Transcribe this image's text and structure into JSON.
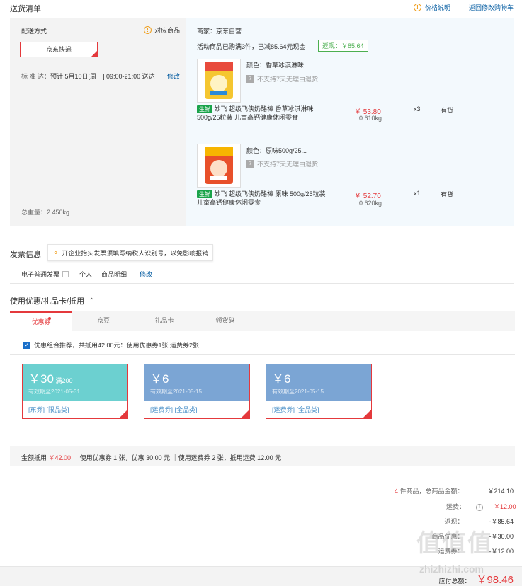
{
  "header": {
    "title": "送货清单",
    "price_explain": "价格说明",
    "back_to_cart": "返回修改购物车"
  },
  "delivery": {
    "label": "配送方式",
    "match_goods": "对应商品",
    "method": "京东快递",
    "standard_label": "标 准 达：",
    "estimate": "预计 5月10日[周一] 09:00-21:00 送达",
    "modify": "修改",
    "total_weight_label": "总重量：",
    "total_weight": "2.450kg"
  },
  "merchant": {
    "label": "商家：",
    "name": "京东自营",
    "promo": "活动商品已购满3件，已减85.64元现金",
    "rebate": "返现：￥85.64"
  },
  "products": [
    {
      "color": "颜色：香草冰淇淋味...",
      "no_return": "不支持7天无理由退货",
      "tag": "生鲜",
      "name": "妙飞 超级飞侠奶酪棒 香草冰淇淋味 500g/25粒装 儿童高钙健康休闲零食",
      "price": "￥ 53.80",
      "weight": "0.610kg",
      "qty": "x3",
      "stock": "有货"
    },
    {
      "color": "颜色：原味500g/25...",
      "no_return": "不支持7天无理由退货",
      "tag": "生鲜",
      "name": "妙飞 超级飞侠奶酪棒 原味 500g/25粒装 儿童高钙健康休闲零食",
      "price": "￥ 52.70",
      "weight": "0.620kg",
      "qty": "x1",
      "stock": "有货"
    }
  ],
  "invoice": {
    "title": "发票信息",
    "tip": "开企业抬头发票须填写纳税人识别号，以免影响报销",
    "type": "电子普通发票",
    "personal": "个人",
    "detail": "商品明细",
    "modify": "修改"
  },
  "coupons": {
    "title": "使用优惠/礼品卡/抵用",
    "tabs": [
      "优惠券",
      "京豆",
      "礼品卡",
      "领货码"
    ],
    "recommend": "优惠组合推荐，共抵用42.00元：使用优惠券1张 运费券2张",
    "cards": [
      {
        "amount": "￥30",
        "cond": "满200",
        "expiry": "有效期至2021-05-31",
        "tags": "[东券] [限品类]",
        "color": "#6cd0d0"
      },
      {
        "amount": "￥6",
        "cond": "",
        "expiry": "有效期至2021-05-15",
        "tags": "[运费券] [全品类]",
        "color": "#7ba5d4"
      },
      {
        "amount": "￥6",
        "cond": "",
        "expiry": "有效期至2021-05-15",
        "tags": "[运费券] [全品类]",
        "color": "#7ba5d4"
      }
    ],
    "deduct_label": "金额抵用",
    "deduct_amount": "￥42.00",
    "deduct_detail": "使用优惠券 1 张，优惠 30.00 元 ｜使用运费券 2 张，抵用运费 12.00 元"
  },
  "summary": {
    "count_num": "4",
    "count_label": "件商品，总商品金额：",
    "goods_total": "￥214.10",
    "freight_label": "运费：",
    "freight": "￥12.00",
    "rebate_label": "返现：",
    "rebate": "-￥85.64",
    "row4_label": "商品优惠：",
    "row4_value": "-￥30.00",
    "row5_label": "运费券：",
    "row5_value": "-￥12.00",
    "payable_label": "应付总额：",
    "payable": "￥98.46"
  },
  "watermark": "值 什么值得买 zhizhizhi.com"
}
